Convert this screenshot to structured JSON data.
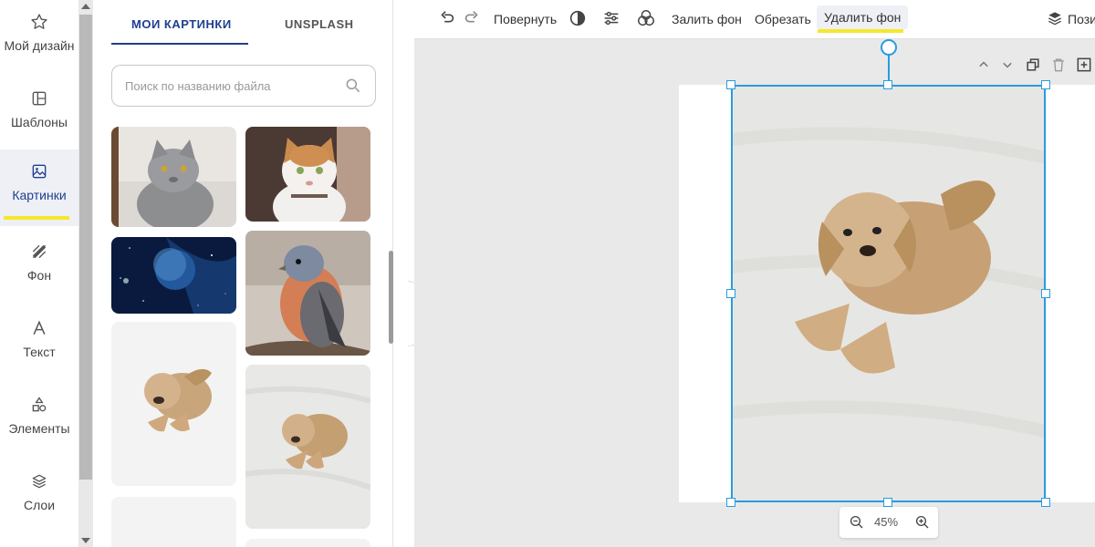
{
  "rail": {
    "items": [
      {
        "label": "Мой дизайн",
        "icon": "star-icon"
      },
      {
        "label": "Шаблоны",
        "icon": "template-icon"
      },
      {
        "label": "Картинки",
        "icon": "image-icon"
      },
      {
        "label": "Фон",
        "icon": "background-icon"
      },
      {
        "label": "Текст",
        "icon": "text-icon"
      },
      {
        "label": "Элементы",
        "icon": "elements-icon"
      },
      {
        "label": "Слои",
        "icon": "layers-icon"
      }
    ]
  },
  "panel": {
    "tabs": [
      "МОИ КАРТИНКИ",
      "UNSPLASH"
    ],
    "search_placeholder": "Поиск по названию файла"
  },
  "toolbar": {
    "rotate": "Повернуть",
    "fill_bg": "Залить фон",
    "crop": "Обрезать",
    "remove_bg": "Удалить фон",
    "position": "Пози"
  },
  "zoom": {
    "level": "45%"
  },
  "colors": {
    "accent": "#1f3f8f",
    "highlight": "#f5e829",
    "selection": "#2a9bde"
  }
}
